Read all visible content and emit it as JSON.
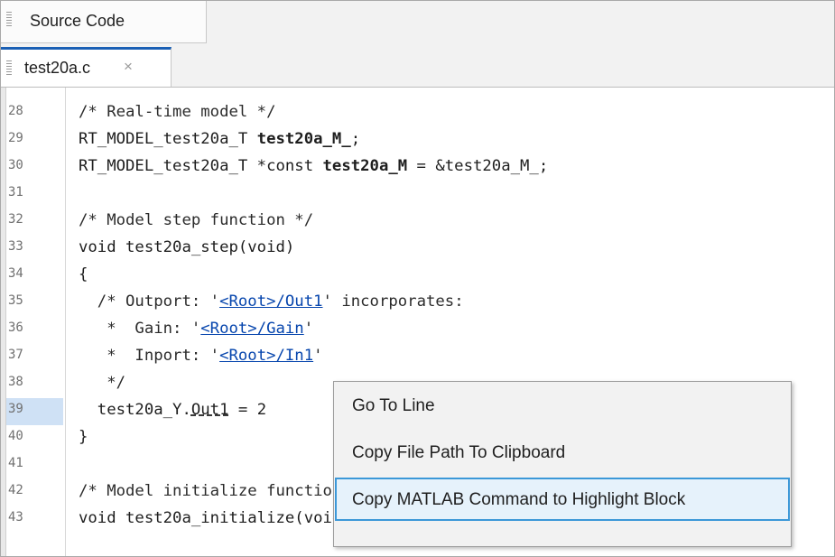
{
  "panel": {
    "title": "Source Code"
  },
  "file_tab": {
    "name": "test20a.c",
    "close_glyph": "×"
  },
  "editor": {
    "current_line": "39",
    "partial_top_line": "27",
    "lines": [
      {
        "num": "28",
        "parts": [
          {
            "t": "/* Real-time model */",
            "k": "cm"
          }
        ]
      },
      {
        "num": "29",
        "parts": [
          {
            "t": "RT_MODEL_test20a_T ",
            "k": ""
          },
          {
            "t": "test20a_M_",
            "k": "b"
          },
          {
            "t": ";",
            "k": ""
          }
        ]
      },
      {
        "num": "30",
        "parts": [
          {
            "t": "RT_MODEL_test20a_T *const ",
            "k": ""
          },
          {
            "t": "test20a_M",
            "k": "b"
          },
          {
            "t": " = &test20a_M_;",
            "k": ""
          }
        ]
      },
      {
        "num": "31",
        "parts": []
      },
      {
        "num": "32",
        "parts": [
          {
            "t": "/* Model step function */",
            "k": "cm"
          }
        ]
      },
      {
        "num": "33",
        "parts": [
          {
            "t": "void test20a_step(void)",
            "k": ""
          }
        ]
      },
      {
        "num": "34",
        "parts": [
          {
            "t": "{",
            "k": ""
          }
        ]
      },
      {
        "num": "35",
        "parts": [
          {
            "t": "  /* Outport: '",
            "k": "cm"
          },
          {
            "t": "<Root>/Out1",
            "k": "lnk"
          },
          {
            "t": "' incorporates:",
            "k": "cm"
          }
        ]
      },
      {
        "num": "36",
        "parts": [
          {
            "t": "   *  Gain: '",
            "k": "cm"
          },
          {
            "t": "<Root>/Gain",
            "k": "lnk"
          },
          {
            "t": "'",
            "k": "cm"
          }
        ]
      },
      {
        "num": "37",
        "parts": [
          {
            "t": "   *  Inport: '",
            "k": "cm"
          },
          {
            "t": "<Root>/In1",
            "k": "lnk"
          },
          {
            "t": "'",
            "k": "cm"
          }
        ]
      },
      {
        "num": "38",
        "parts": [
          {
            "t": "   */",
            "k": "cm"
          }
        ]
      },
      {
        "num": "39",
        "parts": [
          {
            "t": "  test20a_Y.",
            "k": ""
          },
          {
            "t": "Out1",
            "k": "dash"
          },
          {
            "t": " = 2",
            "k": ""
          }
        ]
      },
      {
        "num": "40",
        "parts": [
          {
            "t": "}",
            "k": ""
          }
        ]
      },
      {
        "num": "41",
        "parts": []
      },
      {
        "num": "42",
        "parts": [
          {
            "t": "/* Model initialize function */",
            "k": "cm"
          }
        ]
      },
      {
        "num": "43",
        "parts": [
          {
            "t": "void test20a_initialize(void)",
            "k": ""
          }
        ]
      }
    ]
  },
  "context_menu": {
    "items": [
      {
        "label": "Go To Line"
      },
      {
        "label": "Copy File Path To Clipboard"
      },
      {
        "label": "Copy MATLAB Command to Highlight Block"
      }
    ],
    "hovered_index": 2
  },
  "colors": {
    "link": "#0645ad",
    "tab_accent": "#1a5fb4",
    "current_line": "#cfe1f5",
    "menu_hover_border": "#3c98d8"
  }
}
